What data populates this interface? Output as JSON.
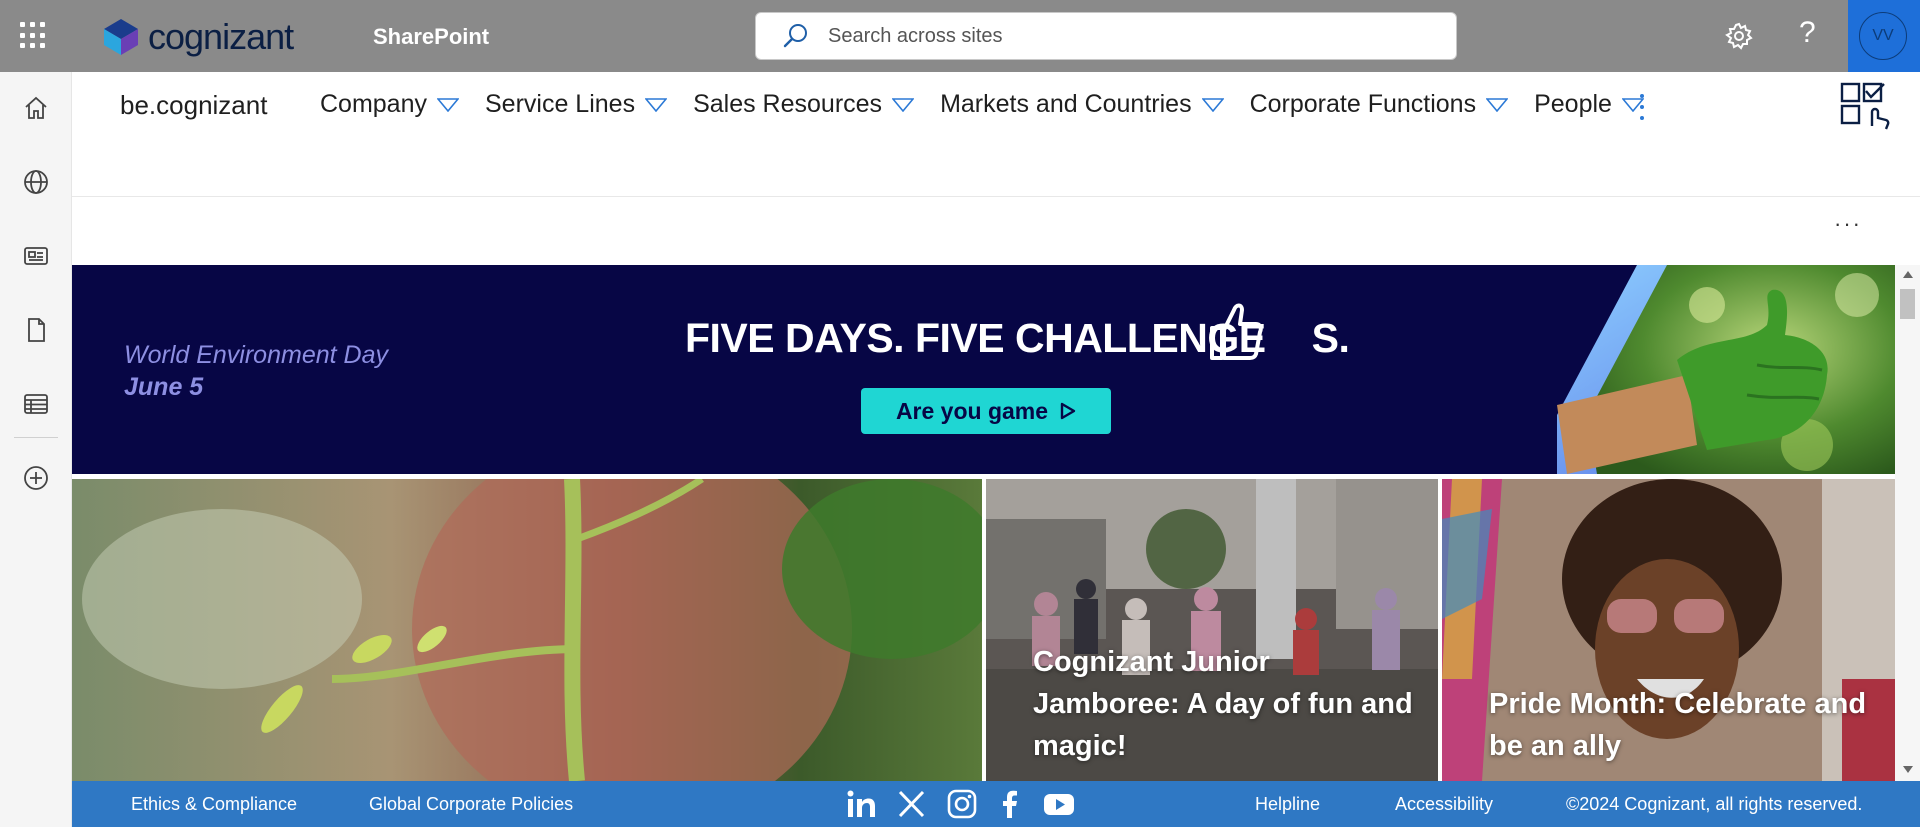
{
  "suitebar": {
    "brand": "cognizant",
    "app_name": "SharePoint",
    "search_placeholder": "Search across sites",
    "help_glyph": "?",
    "avatar_initials": "VV",
    "colors": {
      "bar": "#8a8a8a",
      "avatar_bg": "#1e6fd9"
    }
  },
  "appbar": {
    "icons": [
      "home-icon",
      "globe-icon",
      "news-icon",
      "document-icon",
      "list-icon",
      "add-circle-icon"
    ]
  },
  "hubnav": {
    "site_title": "be.cognizant",
    "items": [
      {
        "label": "Company"
      },
      {
        "label": "Service Lines"
      },
      {
        "label": "Sales Resources"
      },
      {
        "label": "Markets and Countries"
      },
      {
        "label": "Corporate Functions"
      },
      {
        "label": "People"
      }
    ]
  },
  "toolbar": {
    "more": "···"
  },
  "banner": {
    "event_name": "World Environment Day",
    "event_date": "June 5",
    "headline_part1": "FIVE DAYS. FIVE CHALLENGE",
    "headline_part2": "S.",
    "cta_label": "Are you game",
    "colors": {
      "background": "#070645",
      "cta": "#1fd6d3"
    }
  },
  "tiles": [
    {
      "caption": ""
    },
    {
      "caption": "Cognizant Junior Jamboree: A day of fun and magic!"
    },
    {
      "caption": "Pride Month: Celebrate and be an ally"
    }
  ],
  "footer": {
    "links_left": [
      "Ethics & Compliance",
      "Global Corporate Policies"
    ],
    "social": [
      "linkedin-icon",
      "x-icon",
      "instagram-icon",
      "facebook-icon",
      "youtube-icon"
    ],
    "links_right": [
      "Helpline",
      "Accessibility"
    ],
    "copyright": "©2024 Cognizant, all rights reserved.",
    "colors": {
      "background": "#2f78c4"
    }
  }
}
